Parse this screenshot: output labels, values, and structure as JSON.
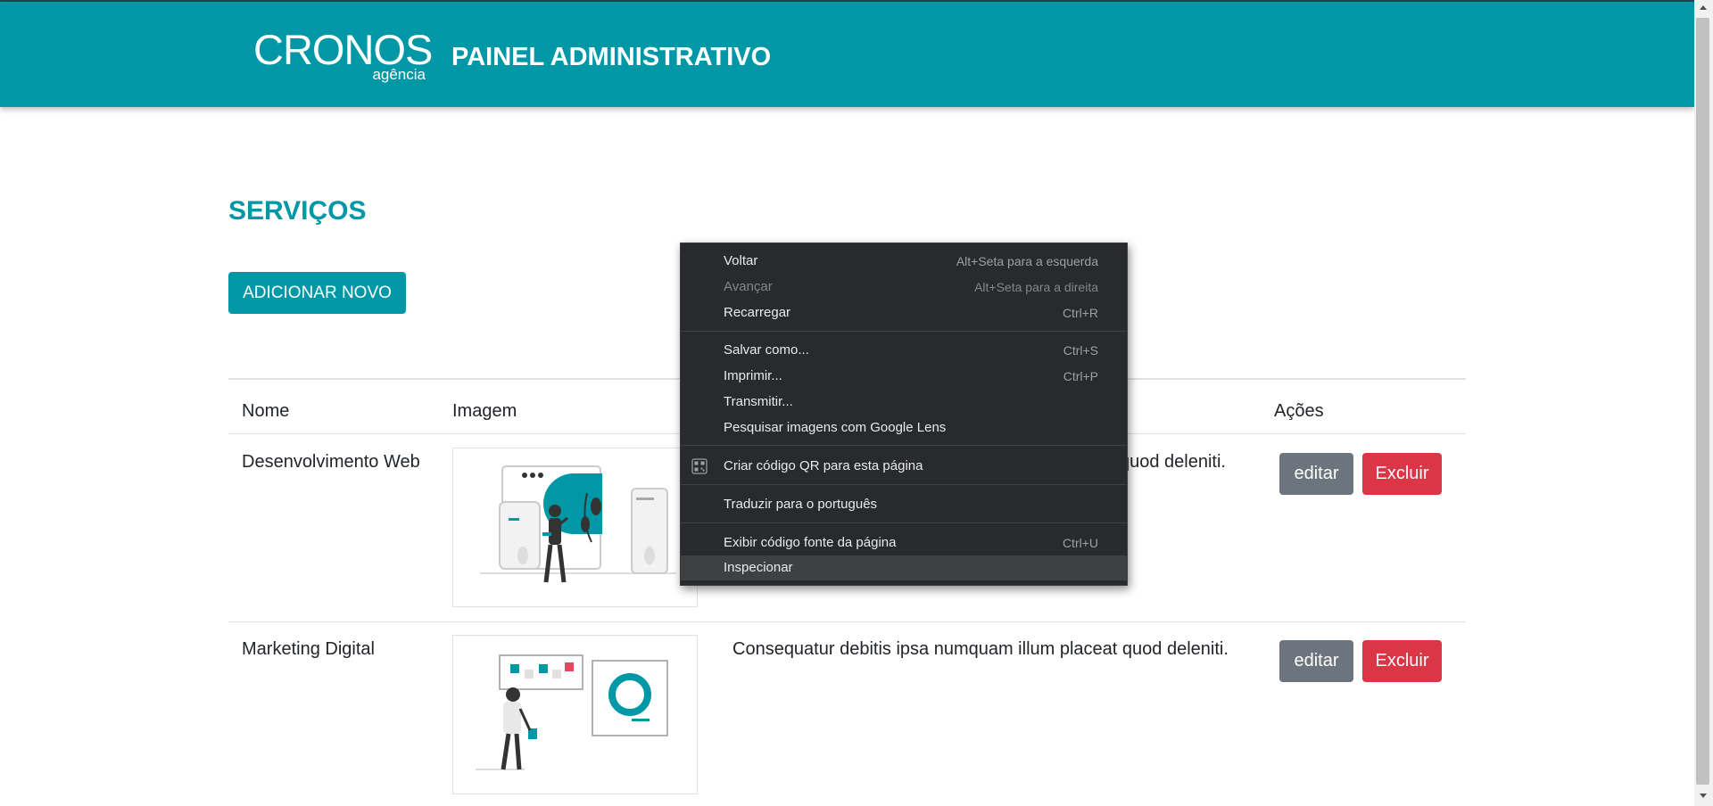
{
  "header": {
    "logo_main": "CRONOS",
    "logo_sub": "agência",
    "title": "PAINEL ADMINISTRATIVO"
  },
  "page": {
    "section_title": "SERVIÇOS",
    "add_button": "ADICIONAR NOVO"
  },
  "table": {
    "columns": [
      "Nome",
      "Imagem",
      "",
      "Ações"
    ],
    "rows": [
      {
        "name": "Desenvolvimento Web",
        "description": "quod deleniti.",
        "image_icon": "web-development-illustration",
        "edit_label": "editar",
        "delete_label": "Excluir"
      },
      {
        "name": "Marketing Digital",
        "description": "Consequatur debitis ipsa numquam illum placeat quod deleniti.",
        "image_icon": "digital-marketing-illustration",
        "edit_label": "editar",
        "delete_label": "Excluir"
      }
    ]
  },
  "context_menu": {
    "items": [
      {
        "label": "Voltar",
        "shortcut": "Alt+Seta para a esquerda",
        "disabled": false
      },
      {
        "label": "Avançar",
        "shortcut": "Alt+Seta para a direita",
        "disabled": true
      },
      {
        "label": "Recarregar",
        "shortcut": "Ctrl+R",
        "disabled": false
      },
      {
        "label": "Salvar como...",
        "shortcut": "Ctrl+S",
        "disabled": false
      },
      {
        "label": "Imprimir...",
        "shortcut": "Ctrl+P",
        "disabled": false
      },
      {
        "label": "Transmitir...",
        "shortcut": "",
        "disabled": false
      },
      {
        "label": "Pesquisar imagens com Google Lens",
        "shortcut": "",
        "disabled": false
      },
      {
        "label": "Criar código QR para esta página",
        "shortcut": "",
        "disabled": false,
        "icon": "qr-code-icon"
      },
      {
        "label": "Traduzir para o português",
        "shortcut": "",
        "disabled": false
      },
      {
        "label": "Exibir código fonte da página",
        "shortcut": "Ctrl+U",
        "disabled": false
      },
      {
        "label": "Inspecionar",
        "shortcut": "",
        "disabled": false,
        "highlighted": true
      }
    ]
  },
  "colors": {
    "brand": "#0097a7",
    "edit": "#6c757d",
    "delete": "#dc3545",
    "menu_bg": "#292a2d"
  }
}
